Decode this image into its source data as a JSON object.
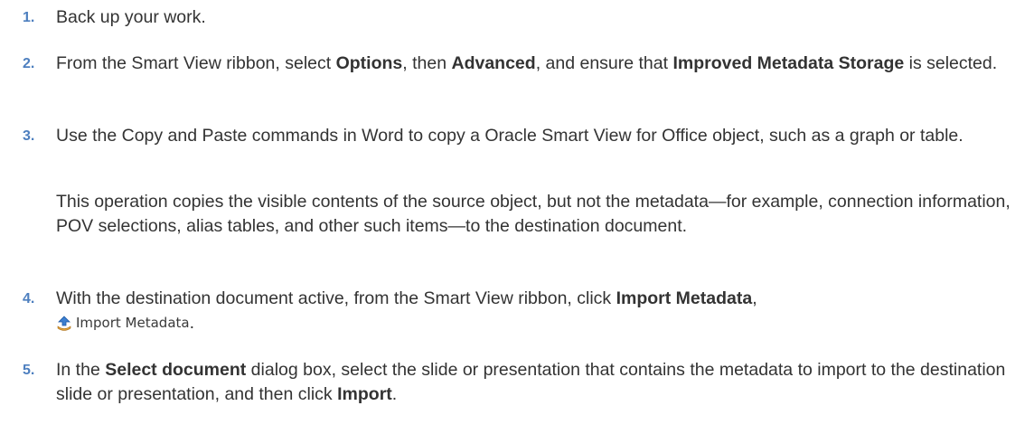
{
  "steps": [
    {
      "number": "1.",
      "text": "Back up your work."
    },
    {
      "number": "2.",
      "t1": "From the Smart View ribbon, select ",
      "b1": "Options",
      "t2": ", then ",
      "b2": "Advanced",
      "t3": ", and ensure that ",
      "b3": "Improved Metadata Storage",
      "t4": " is selected."
    },
    {
      "number": "3.",
      "text": "Use the Copy and Paste commands in Word to copy a Oracle Smart View for Office object, such as a graph or table.",
      "note": "This operation copies the visible contents of the source object, but not the metadata—for example, connection information, POV selections, alias tables, and other such items—to the destination document."
    },
    {
      "number": "4.",
      "t1": "With the destination document active, from the Smart View ribbon, click ",
      "b1": "Import Metadata",
      "t2": ",",
      "icon_label": "Import Metadata",
      "icon": "import-metadata-icon",
      "t3": "."
    },
    {
      "number": "5.",
      "t1": "In the ",
      "b1": "Select document",
      "t2": " dialog box, select the slide or presentation that contains the metadata to import to the destination slide or presentation, and then click ",
      "b2": "Import",
      "t3": "."
    }
  ],
  "colors": {
    "number": "#4d7fbf",
    "text": "#333333"
  }
}
